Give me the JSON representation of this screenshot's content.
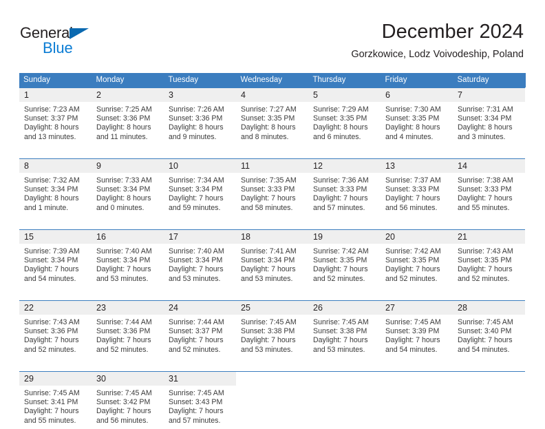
{
  "logo": {
    "word_dark": "General",
    "word_blue": "Blue",
    "flag_color": "#0a69b0",
    "blue_color": "#0a7cd4"
  },
  "header": {
    "title": "December 2024",
    "subtitle": "Gorzkowice, Lodz Voivodeship, Poland"
  },
  "colors": {
    "header_blue": "#3b7dbf",
    "daynum_background": "#efefef",
    "text": "#231f20"
  },
  "calendar": {
    "weekday_headers": [
      "Sunday",
      "Monday",
      "Tuesday",
      "Wednesday",
      "Thursday",
      "Friday",
      "Saturday"
    ],
    "weeks": [
      [
        {
          "day": "1",
          "sunrise": "Sunrise: 7:23 AM",
          "sunset": "Sunset: 3:37 PM",
          "daylight_1": "Daylight: 8 hours",
          "daylight_2": "and 13 minutes."
        },
        {
          "day": "2",
          "sunrise": "Sunrise: 7:25 AM",
          "sunset": "Sunset: 3:36 PM",
          "daylight_1": "Daylight: 8 hours",
          "daylight_2": "and 11 minutes."
        },
        {
          "day": "3",
          "sunrise": "Sunrise: 7:26 AM",
          "sunset": "Sunset: 3:36 PM",
          "daylight_1": "Daylight: 8 hours",
          "daylight_2": "and 9 minutes."
        },
        {
          "day": "4",
          "sunrise": "Sunrise: 7:27 AM",
          "sunset": "Sunset: 3:35 PM",
          "daylight_1": "Daylight: 8 hours",
          "daylight_2": "and 8 minutes."
        },
        {
          "day": "5",
          "sunrise": "Sunrise: 7:29 AM",
          "sunset": "Sunset: 3:35 PM",
          "daylight_1": "Daylight: 8 hours",
          "daylight_2": "and 6 minutes."
        },
        {
          "day": "6",
          "sunrise": "Sunrise: 7:30 AM",
          "sunset": "Sunset: 3:35 PM",
          "daylight_1": "Daylight: 8 hours",
          "daylight_2": "and 4 minutes."
        },
        {
          "day": "7",
          "sunrise": "Sunrise: 7:31 AM",
          "sunset": "Sunset: 3:34 PM",
          "daylight_1": "Daylight: 8 hours",
          "daylight_2": "and 3 minutes."
        }
      ],
      [
        {
          "day": "8",
          "sunrise": "Sunrise: 7:32 AM",
          "sunset": "Sunset: 3:34 PM",
          "daylight_1": "Daylight: 8 hours",
          "daylight_2": "and 1 minute."
        },
        {
          "day": "9",
          "sunrise": "Sunrise: 7:33 AM",
          "sunset": "Sunset: 3:34 PM",
          "daylight_1": "Daylight: 8 hours",
          "daylight_2": "and 0 minutes."
        },
        {
          "day": "10",
          "sunrise": "Sunrise: 7:34 AM",
          "sunset": "Sunset: 3:34 PM",
          "daylight_1": "Daylight: 7 hours",
          "daylight_2": "and 59 minutes."
        },
        {
          "day": "11",
          "sunrise": "Sunrise: 7:35 AM",
          "sunset": "Sunset: 3:33 PM",
          "daylight_1": "Daylight: 7 hours",
          "daylight_2": "and 58 minutes."
        },
        {
          "day": "12",
          "sunrise": "Sunrise: 7:36 AM",
          "sunset": "Sunset: 3:33 PM",
          "daylight_1": "Daylight: 7 hours",
          "daylight_2": "and 57 minutes."
        },
        {
          "day": "13",
          "sunrise": "Sunrise: 7:37 AM",
          "sunset": "Sunset: 3:33 PM",
          "daylight_1": "Daylight: 7 hours",
          "daylight_2": "and 56 minutes."
        },
        {
          "day": "14",
          "sunrise": "Sunrise: 7:38 AM",
          "sunset": "Sunset: 3:33 PM",
          "daylight_1": "Daylight: 7 hours",
          "daylight_2": "and 55 minutes."
        }
      ],
      [
        {
          "day": "15",
          "sunrise": "Sunrise: 7:39 AM",
          "sunset": "Sunset: 3:34 PM",
          "daylight_1": "Daylight: 7 hours",
          "daylight_2": "and 54 minutes."
        },
        {
          "day": "16",
          "sunrise": "Sunrise: 7:40 AM",
          "sunset": "Sunset: 3:34 PM",
          "daylight_1": "Daylight: 7 hours",
          "daylight_2": "and 53 minutes."
        },
        {
          "day": "17",
          "sunrise": "Sunrise: 7:40 AM",
          "sunset": "Sunset: 3:34 PM",
          "daylight_1": "Daylight: 7 hours",
          "daylight_2": "and 53 minutes."
        },
        {
          "day": "18",
          "sunrise": "Sunrise: 7:41 AM",
          "sunset": "Sunset: 3:34 PM",
          "daylight_1": "Daylight: 7 hours",
          "daylight_2": "and 53 minutes."
        },
        {
          "day": "19",
          "sunrise": "Sunrise: 7:42 AM",
          "sunset": "Sunset: 3:35 PM",
          "daylight_1": "Daylight: 7 hours",
          "daylight_2": "and 52 minutes."
        },
        {
          "day": "20",
          "sunrise": "Sunrise: 7:42 AM",
          "sunset": "Sunset: 3:35 PM",
          "daylight_1": "Daylight: 7 hours",
          "daylight_2": "and 52 minutes."
        },
        {
          "day": "21",
          "sunrise": "Sunrise: 7:43 AM",
          "sunset": "Sunset: 3:35 PM",
          "daylight_1": "Daylight: 7 hours",
          "daylight_2": "and 52 minutes."
        }
      ],
      [
        {
          "day": "22",
          "sunrise": "Sunrise: 7:43 AM",
          "sunset": "Sunset: 3:36 PM",
          "daylight_1": "Daylight: 7 hours",
          "daylight_2": "and 52 minutes."
        },
        {
          "day": "23",
          "sunrise": "Sunrise: 7:44 AM",
          "sunset": "Sunset: 3:36 PM",
          "daylight_1": "Daylight: 7 hours",
          "daylight_2": "and 52 minutes."
        },
        {
          "day": "24",
          "sunrise": "Sunrise: 7:44 AM",
          "sunset": "Sunset: 3:37 PM",
          "daylight_1": "Daylight: 7 hours",
          "daylight_2": "and 52 minutes."
        },
        {
          "day": "25",
          "sunrise": "Sunrise: 7:45 AM",
          "sunset": "Sunset: 3:38 PM",
          "daylight_1": "Daylight: 7 hours",
          "daylight_2": "and 53 minutes."
        },
        {
          "day": "26",
          "sunrise": "Sunrise: 7:45 AM",
          "sunset": "Sunset: 3:38 PM",
          "daylight_1": "Daylight: 7 hours",
          "daylight_2": "and 53 minutes."
        },
        {
          "day": "27",
          "sunrise": "Sunrise: 7:45 AM",
          "sunset": "Sunset: 3:39 PM",
          "daylight_1": "Daylight: 7 hours",
          "daylight_2": "and 54 minutes."
        },
        {
          "day": "28",
          "sunrise": "Sunrise: 7:45 AM",
          "sunset": "Sunset: 3:40 PM",
          "daylight_1": "Daylight: 7 hours",
          "daylight_2": "and 54 minutes."
        }
      ],
      [
        {
          "day": "29",
          "sunrise": "Sunrise: 7:45 AM",
          "sunset": "Sunset: 3:41 PM",
          "daylight_1": "Daylight: 7 hours",
          "daylight_2": "and 55 minutes."
        },
        {
          "day": "30",
          "sunrise": "Sunrise: 7:45 AM",
          "sunset": "Sunset: 3:42 PM",
          "daylight_1": "Daylight: 7 hours",
          "daylight_2": "and 56 minutes."
        },
        {
          "day": "31",
          "sunrise": "Sunrise: 7:45 AM",
          "sunset": "Sunset: 3:43 PM",
          "daylight_1": "Daylight: 7 hours",
          "daylight_2": "and 57 minutes."
        },
        {
          "day": "",
          "sunrise": "",
          "sunset": "",
          "daylight_1": "",
          "daylight_2": ""
        },
        {
          "day": "",
          "sunrise": "",
          "sunset": "",
          "daylight_1": "",
          "daylight_2": ""
        },
        {
          "day": "",
          "sunrise": "",
          "sunset": "",
          "daylight_1": "",
          "daylight_2": ""
        },
        {
          "day": "",
          "sunrise": "",
          "sunset": "",
          "daylight_1": "",
          "daylight_2": ""
        }
      ]
    ]
  }
}
